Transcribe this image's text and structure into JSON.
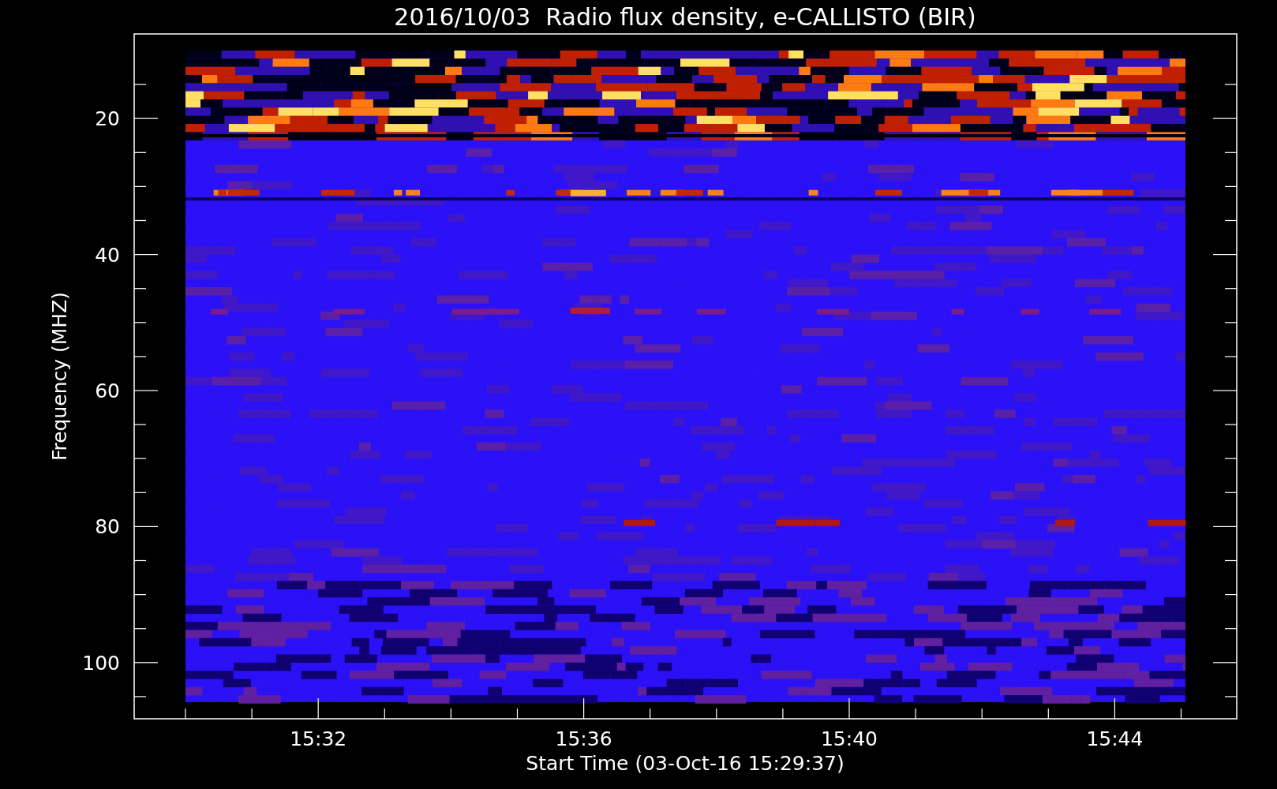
{
  "title": "2016/10/03  Radio flux density, e-CALLISTO (BIR)",
  "y_axis": {
    "label": "Frequency (MHZ)",
    "ticks": [
      "20",
      "40",
      "60",
      "80",
      "100"
    ]
  },
  "x_axis": {
    "label": "Start Time (03-Oct-16 15:29:37)",
    "ticks": [
      "15:32",
      "15:36",
      "15:40",
      "15:44"
    ]
  }
}
